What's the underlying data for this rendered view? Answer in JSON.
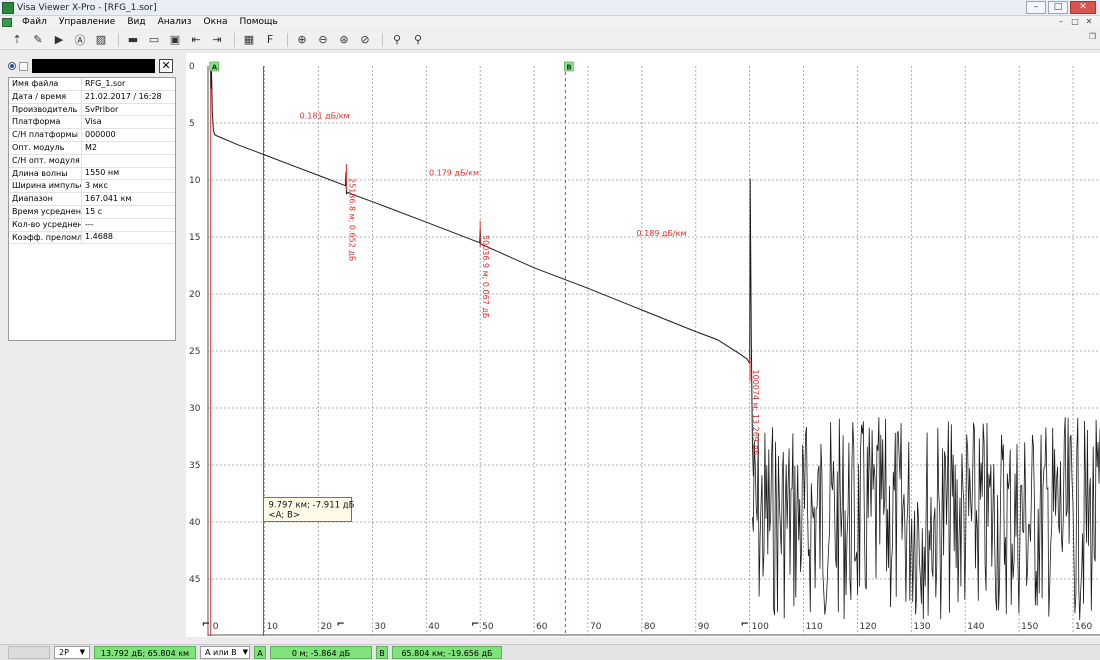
{
  "window": {
    "title": "Visa Viewer X-Pro - [RFG_1.sor]",
    "min": "–",
    "max": "□",
    "close": "✕"
  },
  "menu": {
    "items": [
      "Файл",
      "Управление",
      "Вид",
      "Анализ",
      "Окна",
      "Помощь"
    ],
    "mdi_min": "–",
    "mdi_max": "□",
    "mdi_close": "✕"
  },
  "toolbar": {
    "groups": [
      [
        "pointer-icon",
        "tools-icon",
        "play-icon",
        "auto-icon",
        "image-icon"
      ],
      [
        "open-folder-icon",
        "open-multi-icon",
        "save-icon",
        "import-icon",
        "export-icon"
      ],
      [
        "grid-icon",
        "font-icon"
      ],
      [
        "zoom-in-icon",
        "zoom-out-icon",
        "zoom-fit-icon",
        "zoom-reset-icon"
      ],
      [
        "search-icon",
        "search-alt-icon"
      ]
    ],
    "glyphs": {
      "pointer-icon": "⇡",
      "tools-icon": "✎",
      "play-icon": "▶",
      "auto-icon": "Ⓐ",
      "image-icon": "▨",
      "open-folder-icon": "▬",
      "open-multi-icon": "▭",
      "save-icon": "▣",
      "import-icon": "⇤",
      "export-icon": "⇥",
      "grid-icon": "▦",
      "font-icon": "F",
      "zoom-in-icon": "⊕",
      "zoom-out-icon": "⊖",
      "zoom-fit-icon": "⊛",
      "zoom-reset-icon": "⊘",
      "search-icon": "⚲",
      "search-alt-icon": "⚲"
    },
    "pin": "❒"
  },
  "panel": {
    "close_label": "✕",
    "rows": [
      {
        "key": "Имя файла",
        "value": "RFG_1.sor"
      },
      {
        "key": "Дата / время",
        "value": "21.02.2017 / 16:28"
      },
      {
        "key": "Производитель",
        "value": "SvPribor"
      },
      {
        "key": "Платформа",
        "value": "Visa"
      },
      {
        "key": "С/Н платформы",
        "value": "000000"
      },
      {
        "key": "Опт. модуль",
        "value": "M2"
      },
      {
        "key": "С/Н опт. модуля",
        "value": ""
      },
      {
        "key": "Длина волны",
        "value": "1550 нм"
      },
      {
        "key": "Ширина импульса",
        "value": "3 мкс"
      },
      {
        "key": "Диапазон",
        "value": "167.041 км"
      },
      {
        "key": "Время усреднения",
        "value": "15 с"
      },
      {
        "key": "Кол-во усреднений",
        "value": "---"
      },
      {
        "key": "Коэфф. преломл...",
        "value": "1.4688"
      }
    ]
  },
  "chart_data": {
    "type": "line",
    "xlim": [
      -0.5,
      165
    ],
    "ylim": [
      0,
      50
    ],
    "y_inverted": true,
    "x_ticks": [
      0,
      10,
      20,
      30,
      40,
      50,
      60,
      70,
      80,
      90,
      100,
      110,
      120,
      130,
      140,
      150,
      160
    ],
    "y_ticks": [
      0,
      5,
      10,
      15,
      20,
      25,
      30,
      35,
      40,
      45
    ],
    "grid": true,
    "colors": {
      "trace": "#1a1a1a",
      "event": "#e0302a",
      "marker_bg": "#8fe08a",
      "grid": "#9a9a9a"
    },
    "trace": {
      "x": [
        0,
        0.05,
        0.15,
        0.3,
        0.5,
        0.7,
        1.0,
        5,
        10,
        15,
        20,
        25.0,
        25.1,
        25.2,
        25.5,
        26.0,
        26.5,
        30,
        40,
        49.9,
        50.0,
        50.1,
        50.5,
        51.0,
        51.5,
        60,
        70,
        80,
        90,
        94,
        96,
        98,
        99.5,
        100.0,
        100.1,
        100.3,
        100.5,
        100.7
      ],
      "y": [
        0.2,
        2.0,
        0.4,
        4.0,
        5.6,
        6.0,
        6.1,
        6.9,
        7.8,
        8.7,
        9.6,
        10.5,
        9.3,
        11.2,
        11.1,
        11.2,
        11.3,
        11.9,
        13.7,
        15.5,
        14.3,
        15.6,
        15.7,
        15.8,
        15.9,
        17.7,
        19.5,
        21.4,
        23.3,
        24.0,
        24.6,
        25.2,
        25.7,
        26.1,
        9.9,
        24.0,
        33.0,
        36.0
      ]
    },
    "noise": {
      "x_range": [
        100.5,
        165
      ],
      "y_range": [
        30.8,
        48.7
      ]
    },
    "events": [
      {
        "x": 0.0,
        "style": "solid"
      },
      {
        "x": 9.797,
        "style": "solid",
        "cursor": true
      },
      {
        "x": 25.186,
        "style": "short",
        "label": "25186.8 м; 0.652 дБ"
      },
      {
        "x": 50.0,
        "style": "short",
        "label": "50036.9 м; 0.067 дБ"
      },
      {
        "x": 65.804,
        "style": "dashed"
      },
      {
        "x": 100.074,
        "style": "short",
        "label": "100074 м; 13.269 дБ"
      }
    ],
    "section_labels": [
      {
        "x": 16.5,
        "y": 4.6,
        "text": "0.181 дБ/км"
      },
      {
        "x": 40.5,
        "y": 9.6,
        "text": "0.179 дБ/км"
      },
      {
        "x": 79.0,
        "y": 14.9,
        "text": "0.189 дБ/км"
      }
    ],
    "markers": [
      {
        "name": "A",
        "x": 0.0
      },
      {
        "name": "B",
        "x": 65.804
      }
    ],
    "x_glyphs": [
      {
        "x": 0,
        "text": "⌐"
      },
      {
        "x": 25,
        "text": "⌐"
      },
      {
        "x": 50,
        "text": "⌐"
      },
      {
        "x": 100,
        "text": "⌐"
      }
    ],
    "tooltip": {
      "line1": "9.797 км; -7.911 дБ",
      "line2": "<A; B>",
      "x": 9.797,
      "y": 38.2
    }
  },
  "status": {
    "mode": "2P",
    "ab_value": "13.792 дБ; 65.804 км",
    "select": "A или B",
    "a_tag": "A",
    "a_value": "0 м; -5.864 дБ",
    "b_tag": "B",
    "b_value": "65.804 км; -19.656 дБ",
    "caret": "▼"
  }
}
